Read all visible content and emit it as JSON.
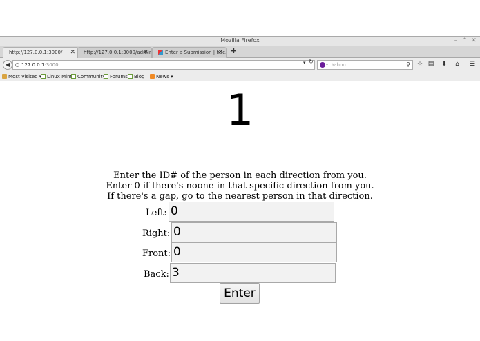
{
  "window": {
    "title": "Mozilla Firefox",
    "controls": {
      "minimize": "–",
      "maximize": "^",
      "close": "✕"
    }
  },
  "tabs": [
    {
      "label": "http://127.0.0.1:3000/",
      "active": true
    },
    {
      "label": "http://127.0.0.1:3000/admin",
      "active": false
    },
    {
      "label": "Enter a Submission | hac...",
      "active": false
    }
  ],
  "tab_close_glyph": "✕",
  "new_tab_glyph": "✚",
  "navbar": {
    "back_glyph": "◀",
    "url_host": "127.0.0.1",
    "url_port": ":3000",
    "url_dropdown_glyph": "▾",
    "reload_glyph": "↻",
    "search_placeholder": "Yahoo",
    "search_engine_dropdown_glyph": "▾",
    "search_glyph": "⚲",
    "tools": {
      "bookmark_star": "☆",
      "bookmarks_menu": "▤",
      "downloads": "⬇",
      "home": "⌂",
      "menu": "☰"
    }
  },
  "bookmarks": [
    {
      "label": "Most Visited ▾",
      "icon": "folder-icon"
    },
    {
      "label": "Linux Mint",
      "icon": "page-icon"
    },
    {
      "label": "Community",
      "icon": "page-icon"
    },
    {
      "label": "Forums",
      "icon": "page-icon"
    },
    {
      "label": "Blog",
      "icon": "page-icon"
    },
    {
      "label": "News ▾",
      "icon": "rss-icon"
    }
  ],
  "page": {
    "id_number": "1",
    "instructions": [
      "Enter the ID# of the person in each direction from you.",
      "Enter 0 if there's noone in that specific direction from you.",
      "If there's a gap, go to the nearest person in that direction."
    ],
    "fields": [
      {
        "label": "Left:",
        "value": "0"
      },
      {
        "label": "Right:",
        "value": "0"
      },
      {
        "label": "Front:",
        "value": "0"
      },
      {
        "label": "Back:",
        "value": "3"
      }
    ],
    "submit_label": "Enter"
  }
}
